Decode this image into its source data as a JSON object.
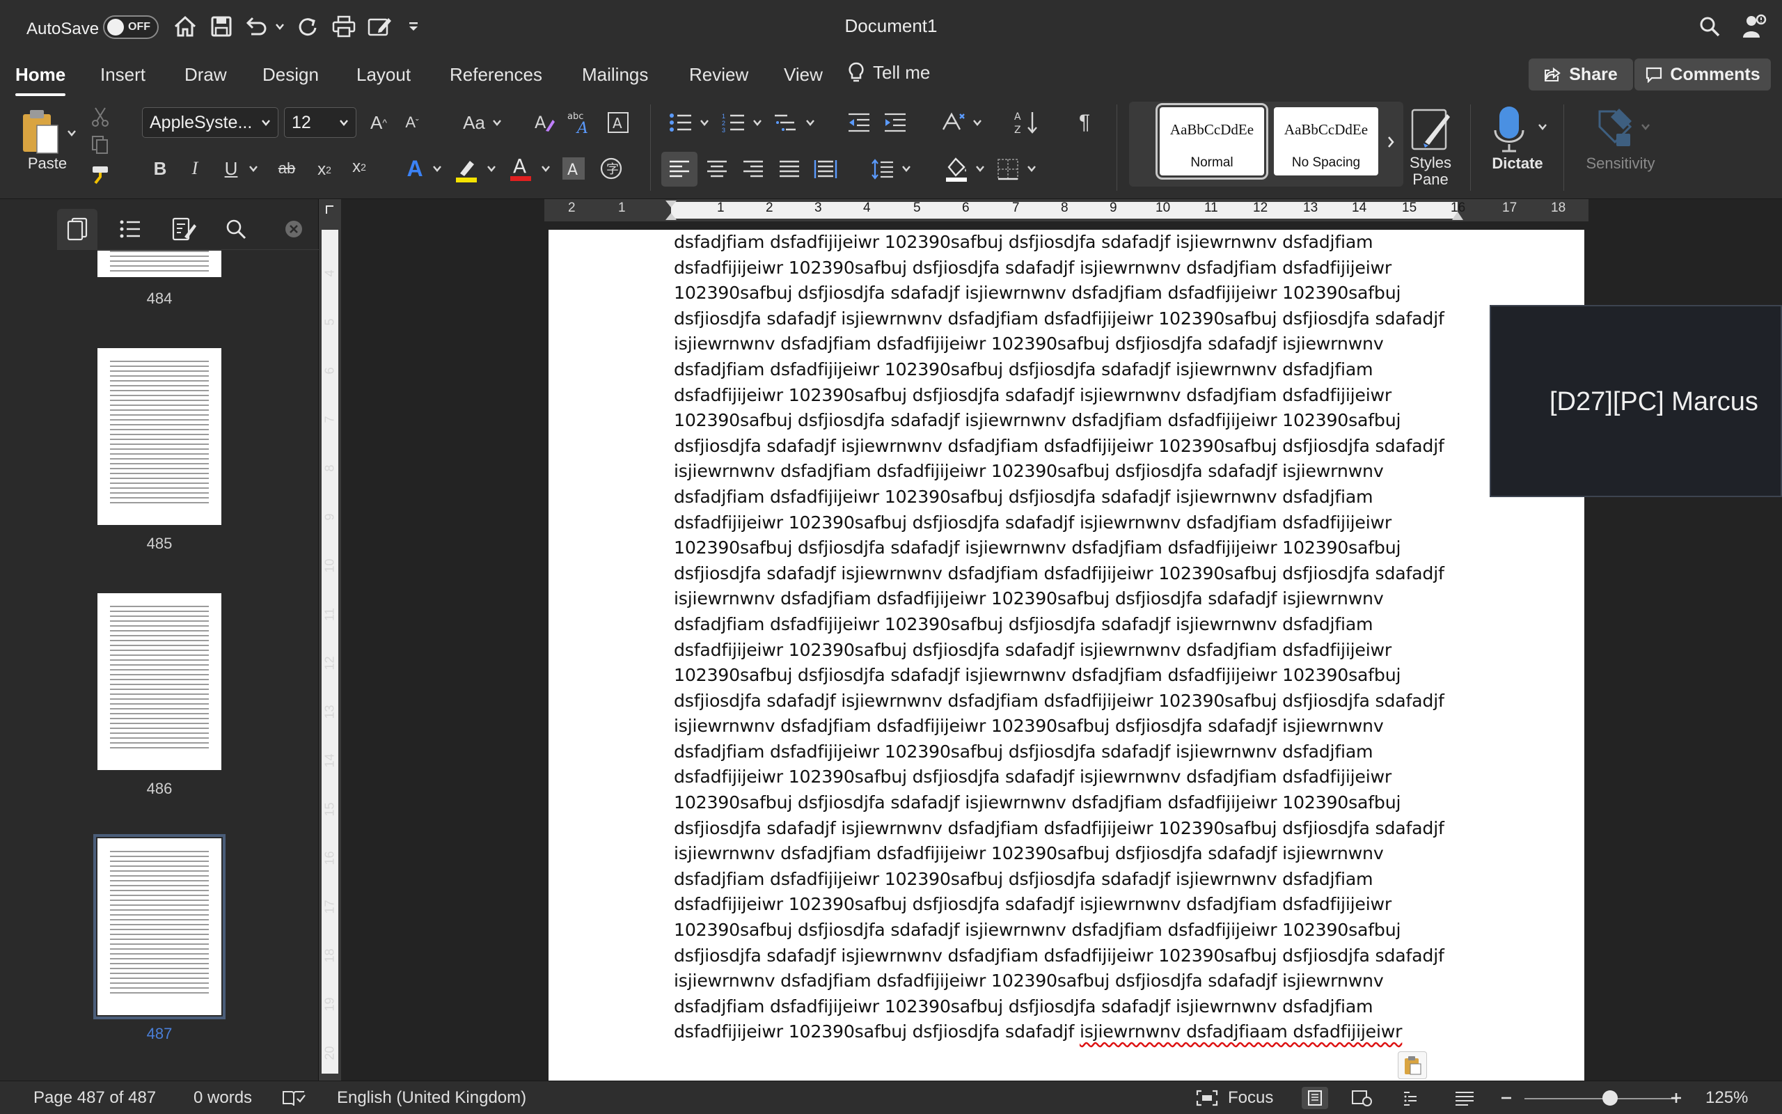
{
  "titlebar": {
    "autosave_label": "AutoSave",
    "autosave_state": "OFF",
    "doc_title": "Document1",
    "qat_icons": [
      "home-icon",
      "save-icon",
      "undo-icon",
      "redo-icon",
      "print-icon",
      "edit-doc-icon",
      "customize-qat-icon"
    ]
  },
  "tabs": [
    "Home",
    "Insert",
    "Draw",
    "Design",
    "Layout",
    "References",
    "Mailings",
    "Review",
    "View"
  ],
  "active_tab": "Home",
  "tell_me": "Tell me",
  "share_label": "Share",
  "comments_label": "Comments",
  "ribbon": {
    "paste_label": "Paste",
    "font_name": "AppleSyste...",
    "font_size": "12",
    "styles": [
      {
        "sample": "AaBbCcDdEe",
        "name": "Normal",
        "selected": true
      },
      {
        "sample": "AaBbCcDdEe",
        "name": "No Spacing",
        "selected": false
      }
    ],
    "styles_pane_label_1": "Styles",
    "styles_pane_label_2": "Pane",
    "dictate_label": "Dictate",
    "sensitivity_label": "Sensitivity"
  },
  "nav_pane": {
    "icons": [
      "thumbnails-icon",
      "headings-icon",
      "search-results-icon",
      "search-icon"
    ],
    "pages": [
      {
        "label": "484",
        "current": false
      },
      {
        "label": "485",
        "current": false
      },
      {
        "label": "486",
        "current": false
      },
      {
        "label": "487",
        "current": true
      }
    ]
  },
  "rulers": {
    "horizontal": [
      "2",
      "1",
      "1",
      "2",
      "3",
      "4",
      "5",
      "6",
      "7",
      "8",
      "9",
      "10",
      "11",
      "12",
      "13",
      "14",
      "15",
      "16",
      "17",
      "18"
    ],
    "vertical": [
      "4",
      "5",
      "6",
      "7",
      "8",
      "9",
      "10",
      "11",
      "12",
      "13",
      "14",
      "15",
      "16",
      "17",
      "18",
      "19",
      "20"
    ]
  },
  "document": {
    "lines": [
      "dsfadjfiam dsfadfijijeiwr 102390safbuj dsfjiosdjfa sdafadjf isjiewrnwnv dsfadjfiam",
      "dsfadfijijeiwr 102390safbuj dsfjiosdjfa sdafadjf isjiewrnwnv dsfadjfiam dsfadfijijeiwr",
      "102390safbuj dsfjiosdjfa sdafadjf isjiewrnwnv dsfadjfiam dsfadfijijeiwr 102390safbuj",
      "dsfjiosdjfa sdafadjf isjiewrnwnv dsfadjfiam dsfadfijijeiwr 102390safbuj dsfjiosdjfa sdafadjf",
      "isjiewrnwnv dsfadjfiam dsfadfijijeiwr 102390safbuj dsfjiosdjfa sdafadjf isjiewrnwnv",
      "dsfadjfiam dsfadfijijeiwr 102390safbuj dsfjiosdjfa sdafadjf isjiewrnwnv dsfadjfiam",
      "dsfadfijijeiwr 102390safbuj dsfjiosdjfa sdafadjf isjiewrnwnv dsfadjfiam dsfadfijijeiwr",
      "102390safbuj dsfjiosdjfa sdafadjf isjiewrnwnv dsfadjfiam dsfadfijijeiwr 102390safbuj",
      "dsfjiosdjfa sdafadjf isjiewrnwnv dsfadjfiam dsfadfijijeiwr 102390safbuj dsfjiosdjfa sdafadjf",
      "isjiewrnwnv dsfadjfiam dsfadfijijeiwr 102390safbuj dsfjiosdjfa sdafadjf isjiewrnwnv",
      "dsfadjfiam dsfadfijijeiwr 102390safbuj dsfjiosdjfa sdafadjf isjiewrnwnv dsfadjfiam",
      "dsfadfijijeiwr 102390safbuj dsfjiosdjfa sdafadjf isjiewrnwnv dsfadjfiam dsfadfijijeiwr",
      "102390safbuj dsfjiosdjfa sdafadjf isjiewrnwnv dsfadjfiam dsfadfijijeiwr 102390safbuj",
      "dsfjiosdjfa sdafadjf isjiewrnwnv dsfadjfiam dsfadfijijeiwr 102390safbuj dsfjiosdjfa sdafadjf",
      "isjiewrnwnv dsfadjfiam dsfadfijijeiwr 102390safbuj dsfjiosdjfa sdafadjf isjiewrnwnv",
      "dsfadjfiam dsfadfijijeiwr 102390safbuj dsfjiosdjfa sdafadjf isjiewrnwnv dsfadjfiam",
      "dsfadfijijeiwr 102390safbuj dsfjiosdjfa sdafadjf isjiewrnwnv dsfadjfiam dsfadfijijeiwr",
      "102390safbuj dsfjiosdjfa sdafadjf isjiewrnwnv dsfadjfiam dsfadfijijeiwr 102390safbuj",
      "dsfjiosdjfa sdafadjf isjiewrnwnv dsfadjfiam dsfadfijijeiwr 102390safbuj dsfjiosdjfa sdafadjf",
      "isjiewrnwnv dsfadjfiam dsfadfijijeiwr 102390safbuj dsfjiosdjfa sdafadjf isjiewrnwnv",
      "dsfadjfiam dsfadfijijeiwr 102390safbuj dsfjiosdjfa sdafadjf isjiewrnwnv dsfadjfiam",
      "dsfadfijijeiwr 102390safbuj dsfjiosdjfa sdafadjf isjiewrnwnv dsfadjfiam dsfadfijijeiwr",
      "102390safbuj dsfjiosdjfa sdafadjf isjiewrnwnv dsfadjfiam dsfadfijijeiwr 102390safbuj",
      "dsfjiosdjfa sdafadjf isjiewrnwnv dsfadjfiam dsfadfijijeiwr 102390safbuj dsfjiosdjfa sdafadjf",
      "isjiewrnwnv dsfadjfiam dsfadfijijeiwr 102390safbuj dsfjiosdjfa sdafadjf isjiewrnwnv",
      "dsfadjfiam dsfadfijijeiwr 102390safbuj dsfjiosdjfa sdafadjf isjiewrnwnv dsfadjfiam",
      "dsfadfijijeiwr 102390safbuj dsfjiosdjfa sdafadjf isjiewrnwnv dsfadjfiam dsfadfijijeiwr",
      "102390safbuj dsfjiosdjfa sdafadjf isjiewrnwnv dsfadjfiam dsfadfijijeiwr 102390safbuj",
      "dsfjiosdjfa sdafadjf isjiewrnwnv dsfadjfiam dsfadfijijeiwr 102390safbuj dsfjiosdjfa sdafadjf",
      "isjiewrnwnv dsfadjfiam dsfadfijijeiwr 102390safbuj dsfjiosdjfa sdafadjf isjiewrnwnv",
      "dsfadjfiam dsfadfijijeiwr 102390safbuj dsfjiosdjfa sdafadjf isjiewrnwnv dsfadjfiam"
    ],
    "last_line_plain": "dsfadfijijeiwr 102390safbuj dsfjiosdjfa sdafadjf ",
    "last_line_squiggled": "isjiewrnwnv dsfadjfiaam dsfadfijijeiwr"
  },
  "collaborator": {
    "name": "[D27][PC] Marcus"
  },
  "statusbar": {
    "page_info": "Page 487 of 487",
    "word_count": "0 words",
    "language": "English (United Kingdom)",
    "focus_label": "Focus",
    "zoom": "125%",
    "zoom_level_fraction": 0.56
  },
  "colors": {
    "font_color": "#e02020",
    "highlight_color": "#f5e300",
    "text_effects": "#3b82f6",
    "dictate_mic": "#4a90e2"
  }
}
